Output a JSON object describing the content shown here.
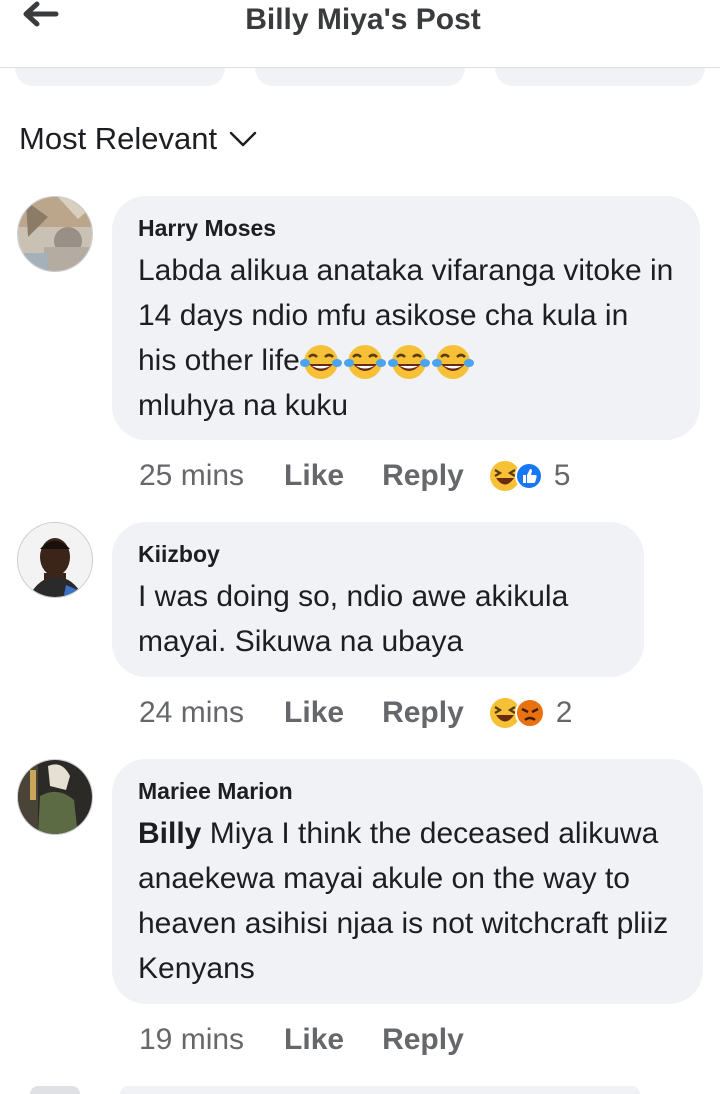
{
  "header": {
    "title": "Billy Miya's Post",
    "back_icon": "arrow-left-icon"
  },
  "sort": {
    "label": "Most Relevant",
    "icon": "chevron-down-icon"
  },
  "comments": [
    {
      "author": "Harry Moses",
      "text_parts": [
        "Labda alikua anataka vifaranga vitoke in 14 days ndio mfu asikose cha kula in his other life",
        "mluhya na kuku"
      ],
      "inline_emojis": [
        "tears-of-joy",
        "tears-of-joy",
        "tears-of-joy",
        "tears-of-joy"
      ],
      "time": "25 mins",
      "like": "Like",
      "reply": "Reply",
      "reactions": [
        "haha",
        "like"
      ],
      "reaction_count": "5"
    },
    {
      "author": "Kiizboy",
      "text": "I was doing so, ndio awe akikula mayai. Sikuwa na ubaya",
      "time": "24 mins",
      "like": "Like",
      "reply": "Reply",
      "reactions": [
        "haha",
        "angry"
      ],
      "reaction_count": "2"
    },
    {
      "author": "Mariee Marion",
      "mention": "Billy",
      "text": "Miya  I think the deceased alikuwa anaekewa mayai akule on the way to heaven asihisi njaa is not witchcraft pliiz Kenyans",
      "time": "19 mins",
      "like": "Like",
      "reply": "Reply"
    }
  ],
  "colors": {
    "bubble": "#f0f2f5",
    "meta_text": "#65676b",
    "like_blue": "#1877f2",
    "haha_yellow": "#f7c137",
    "angry_red": "#e9710f"
  }
}
